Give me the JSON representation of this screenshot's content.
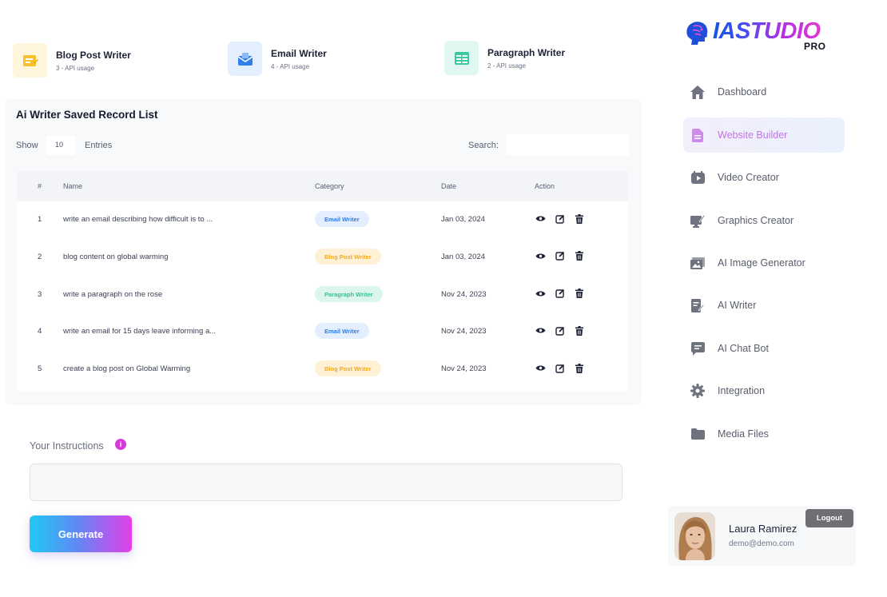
{
  "stats": [
    {
      "title": "Blog Post Writer",
      "sub": "3 - API usage",
      "icon": "note-icon",
      "bg": "#fff5dc",
      "fg": "#f6c12e"
    },
    {
      "title": "Email Writer",
      "sub": "4 - API usage",
      "icon": "mail-icon",
      "bg": "#e3efff",
      "fg": "#2f80ed"
    },
    {
      "title": "Paragraph Writer",
      "sub": "2 - API usage",
      "icon": "table-icon",
      "bg": "#dff7f0",
      "fg": "#3cc9a2"
    }
  ],
  "panel": {
    "title": "Ai Writer Saved Record List",
    "show_label": "Show",
    "entries_value": "10",
    "entries_label": "Entries",
    "search_label": "Search:",
    "search_value": ""
  },
  "table": {
    "headers": [
      "#",
      "Name",
      "Category",
      "Date",
      "Action"
    ],
    "rows": [
      {
        "num": "1",
        "name": "write an email describing how difficult is to ...",
        "category": "Email Writer",
        "cat_key": "email",
        "date": "Jan 03, 2024"
      },
      {
        "num": "2",
        "name": "blog content on global warming",
        "category": "Blog Post Writer",
        "cat_key": "blog",
        "date": "Jan 03, 2024"
      },
      {
        "num": "3",
        "name": "write a paragraph on the rose",
        "category": "Paragraph Writer",
        "cat_key": "para",
        "date": "Nov 24, 2023"
      },
      {
        "num": "4",
        "name": "write an email for 15 days leave informing a...",
        "category": "Email Writer",
        "cat_key": "email",
        "date": "Nov 24, 2023"
      },
      {
        "num": "5",
        "name": "create a blog post on Global Warming",
        "category": "Blog Post Writer",
        "cat_key": "blog",
        "date": "Nov 24, 2023"
      }
    ],
    "badge_colors": {
      "email": {
        "bg": "#e3efff",
        "fg": "#2f7be6"
      },
      "blog": {
        "bg": "#fff1d6",
        "fg": "#f2a91f"
      },
      "para": {
        "bg": "#dcf6ee",
        "fg": "#33c194"
      }
    }
  },
  "instructions": {
    "label": "Your Instructions",
    "info_glyph": "i",
    "value": "",
    "generate_label": "Generate"
  },
  "brand": {
    "name": "IASTUDIO",
    "suffix": "PRO"
  },
  "nav": [
    {
      "label": "Dashboard",
      "icon": "home-icon",
      "active": false
    },
    {
      "label": "Website Builder",
      "icon": "document-icon",
      "active": true
    },
    {
      "label": "Video Creator",
      "icon": "video-icon",
      "active": false
    },
    {
      "label": "Graphics Creator",
      "icon": "graphics-icon",
      "active": false
    },
    {
      "label": "AI Image Generator",
      "icon": "image-icon",
      "active": false
    },
    {
      "label": "AI Writer",
      "icon": "writer-icon",
      "active": false
    },
    {
      "label": "AI Chat Bot",
      "icon": "chat-icon",
      "active": false
    },
    {
      "label": "Integration",
      "icon": "gear-icon",
      "active": false
    },
    {
      "label": "Media Files",
      "icon": "folder-icon",
      "active": false
    }
  ],
  "user": {
    "name": "Laura Ramirez",
    "email": "demo@demo.com",
    "logout_label": "Logout"
  },
  "colors": {
    "accent": "#c076e6",
    "icon_gray": "#6f7380",
    "action_icon": "#1c2134"
  }
}
